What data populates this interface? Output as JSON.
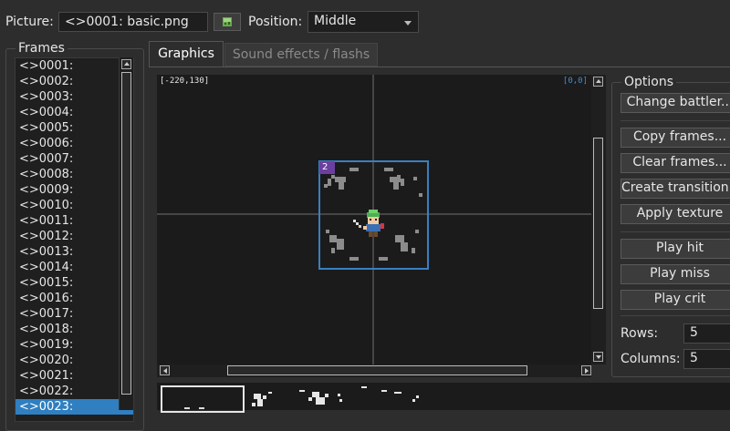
{
  "picture": {
    "label": "Picture:",
    "value": "<>0001: basic.png"
  },
  "position": {
    "label": "Position:",
    "value": "Middle"
  },
  "frames": {
    "title": "Frames",
    "items": [
      "<>0001:",
      "<>0002:",
      "<>0003:",
      "<>0004:",
      "<>0005:",
      "<>0006:",
      "<>0007:",
      "<>0008:",
      "<>0009:",
      "<>0010:",
      "<>0011:",
      "<>0012:",
      "<>0013:",
      "<>0014:",
      "<>0015:",
      "<>0016:",
      "<>0017:",
      "<>0018:",
      "<>0019:",
      "<>0020:",
      "<>0021:",
      "<>0022:",
      "<>0023:"
    ],
    "selected": "<>0023:"
  },
  "tabs": [
    {
      "label": "Graphics",
      "active": true
    },
    {
      "label": "Sound effects / flashs",
      "active": false
    }
  ],
  "canvas": {
    "coord_left": "[-220,130]",
    "coord_right": "[0,0]",
    "cell_number": "2"
  },
  "options": {
    "title": "Options",
    "change_battler": "Change battler...",
    "copy_frames": "Copy frames...",
    "clear_frames": "Clear frames...",
    "create_transition": "Create transition...",
    "apply_texture": "Apply texture",
    "play_hit": "Play hit",
    "play_miss": "Play miss",
    "play_crit": "Play crit",
    "rows_label": "Rows:",
    "rows_value": "5",
    "columns_label": "Columns:",
    "columns_value": "5"
  },
  "colors": {
    "accent": "#2f7fc1",
    "selection_box": "#3a7fc0",
    "cell_badge": "#6b3fa0"
  }
}
